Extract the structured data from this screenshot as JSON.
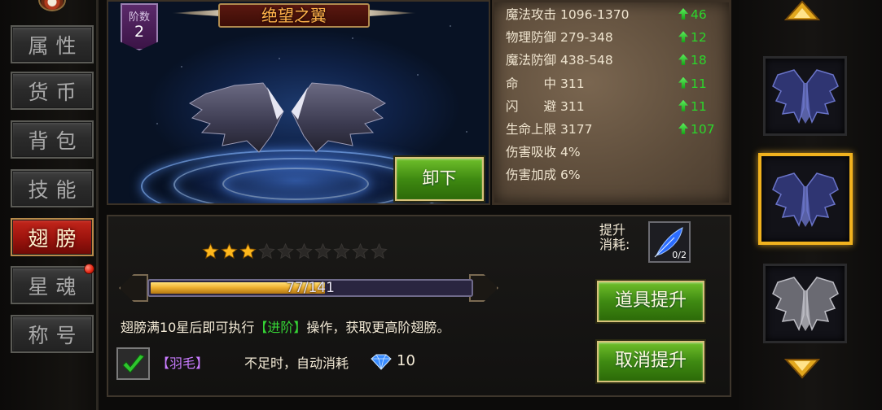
{
  "tabs": [
    {
      "label": "属性",
      "active": false,
      "dot": false
    },
    {
      "label": "货币",
      "active": false,
      "dot": false
    },
    {
      "label": "背包",
      "active": false,
      "dot": false
    },
    {
      "label": "技能",
      "active": false,
      "dot": false
    },
    {
      "label": "翅膀",
      "active": true,
      "dot": false
    },
    {
      "label": "星魂",
      "active": false,
      "dot": true
    },
    {
      "label": "称号",
      "active": false,
      "dot": false
    }
  ],
  "wing": {
    "rank_label": "阶数",
    "rank": "2",
    "name": "绝望之翼",
    "unequip_label": "卸下"
  },
  "stats": [
    {
      "name": "魔法攻击",
      "value": "1096-1370",
      "increase": "46"
    },
    {
      "name": "物理防御",
      "value": "279-348",
      "increase": "12"
    },
    {
      "name": "魔法防御",
      "value": "438-548",
      "increase": "18"
    },
    {
      "name": "命　　中",
      "value": "311",
      "increase": "11"
    },
    {
      "name": "闪　　避",
      "value": "311",
      "increase": "11"
    },
    {
      "name": "生命上限",
      "value": "3177",
      "increase": "107"
    },
    {
      "name": "伤害吸收",
      "value": "4%",
      "increase": ""
    },
    {
      "name": "伤害加成",
      "value": "6%",
      "increase": ""
    }
  ],
  "stars": {
    "filled": 3,
    "total": 10
  },
  "progress": {
    "current": 77,
    "max": 141,
    "text": "77/141"
  },
  "hint": {
    "prefix": "翅膀满10星后即可执行",
    "highlight": "【进阶】",
    "suffix": "操作，获取更高阶翅膀。"
  },
  "auto_consume": {
    "checked": true,
    "item_label": "【羽毛】",
    "text": "不足时，自动消耗",
    "gem_cost": "10"
  },
  "cost": {
    "label_line1": "提升",
    "label_line2": "消耗:",
    "item_count": "0/2"
  },
  "buttons": {
    "item_upgrade": "道具提升",
    "cancel_upgrade": "取消提升"
  },
  "wing_list": [
    {
      "style": "dark-blue",
      "selected": false
    },
    {
      "style": "dark-blue",
      "selected": true
    },
    {
      "style": "silver",
      "selected": false
    }
  ],
  "colors": {
    "active_tab": "#b51c13",
    "increase_green": "#2bd62b",
    "selected_border": "#f1b21e",
    "feather_label": "#c97cff",
    "hint_highlight": "#36d636"
  }
}
